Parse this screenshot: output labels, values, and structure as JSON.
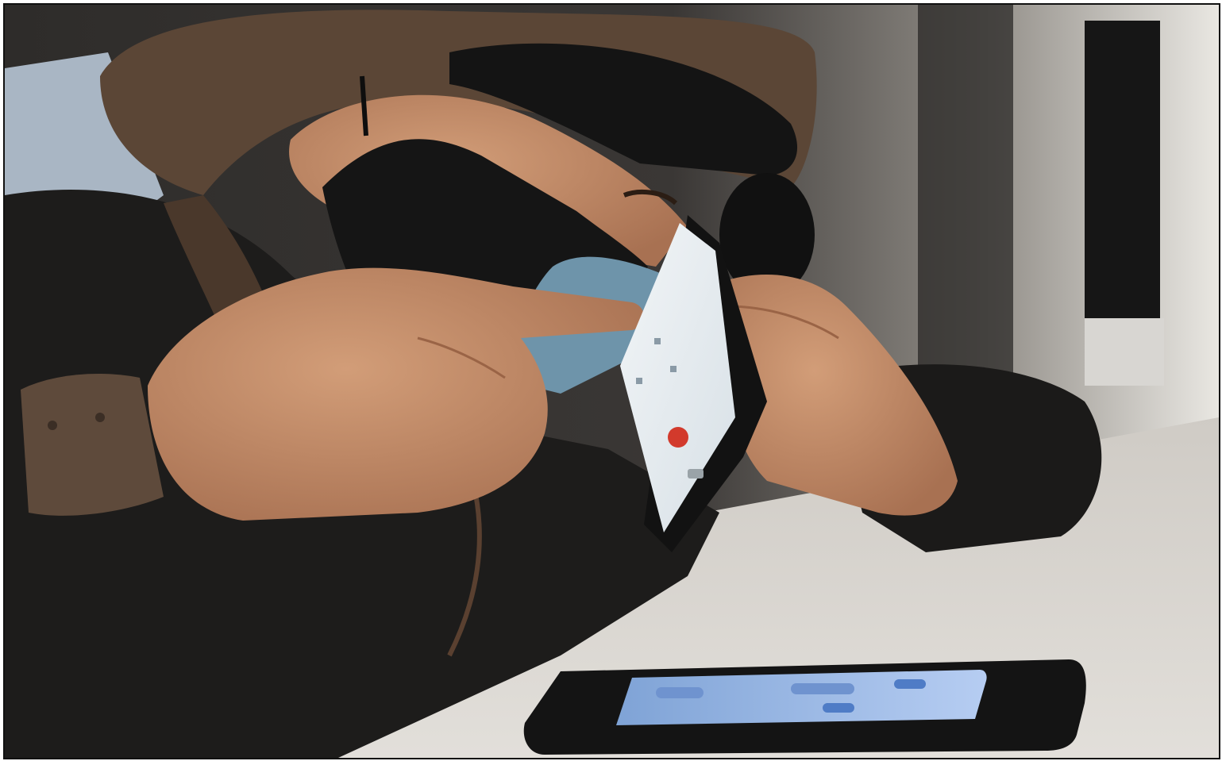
{
  "photo": {
    "colors": {
      "background_wall": "#3a3735",
      "window_light": "#e9e7e2",
      "desk": "#d9d6d1",
      "hood": "#5b4636",
      "cap": "#141414",
      "jacket": "#1d1c1b",
      "skin": "#c48f6a",
      "black_mask": "#151515",
      "blue_mask": "#6e94aa",
      "phone_screen": "#e4ebef",
      "end_call": "#d23a2c",
      "desk_phone_screen": "#9cbcea"
    }
  }
}
